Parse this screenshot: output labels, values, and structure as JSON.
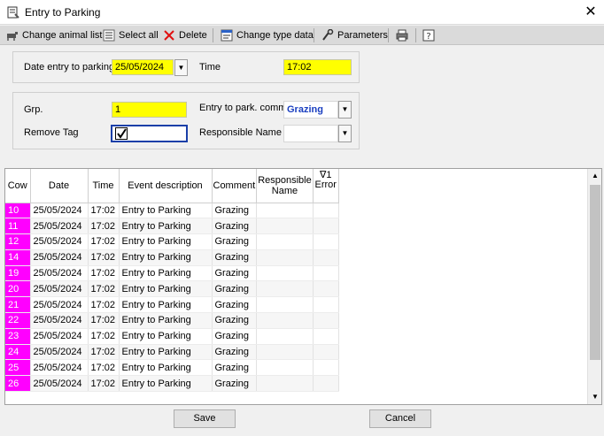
{
  "window": {
    "title": "Entry to Parking",
    "close_glyph": "✕"
  },
  "toolbar": {
    "change_animal_list": "Change animal list",
    "select_all": "Select all",
    "delete": "Delete",
    "change_type_data": "Change type data",
    "parameters": "Parameters"
  },
  "entry": {
    "date_label": "Date entry to parking",
    "date_value": "25/05/2024",
    "time_label": "Time",
    "time_value": "17:02"
  },
  "details": {
    "grp_label": "Grp.",
    "grp_value": "1",
    "comm_label": "Entry to park. comm.",
    "comm_value": "Grazing",
    "remove_tag_label": "Remove Tag",
    "remove_tag_checked": true,
    "responsible_label": "Responsible Name",
    "responsible_value": ""
  },
  "grid": {
    "columns": {
      "cow": "Cow",
      "date": "Date",
      "time": "Time",
      "event": "Event description",
      "comment": "Comment",
      "responsible": "Responsible Name",
      "error_marker": "∇1",
      "error": "Error"
    },
    "rows": [
      {
        "cow": "10",
        "date": "25/05/2024",
        "time": "17:02",
        "event": "Entry to Parking",
        "comment": "Grazing"
      },
      {
        "cow": "11",
        "date": "25/05/2024",
        "time": "17:02",
        "event": "Entry to Parking",
        "comment": "Grazing"
      },
      {
        "cow": "12",
        "date": "25/05/2024",
        "time": "17:02",
        "event": "Entry to Parking",
        "comment": "Grazing"
      },
      {
        "cow": "14",
        "date": "25/05/2024",
        "time": "17:02",
        "event": "Entry to Parking",
        "comment": "Grazing"
      },
      {
        "cow": "19",
        "date": "25/05/2024",
        "time": "17:02",
        "event": "Entry to Parking",
        "comment": "Grazing"
      },
      {
        "cow": "20",
        "date": "25/05/2024",
        "time": "17:02",
        "event": "Entry to Parking",
        "comment": "Grazing"
      },
      {
        "cow": "21",
        "date": "25/05/2024",
        "time": "17:02",
        "event": "Entry to Parking",
        "comment": "Grazing"
      },
      {
        "cow": "22",
        "date": "25/05/2024",
        "time": "17:02",
        "event": "Entry to Parking",
        "comment": "Grazing"
      },
      {
        "cow": "23",
        "date": "25/05/2024",
        "time": "17:02",
        "event": "Entry to Parking",
        "comment": "Grazing"
      },
      {
        "cow": "24",
        "date": "25/05/2024",
        "time": "17:02",
        "event": "Entry to Parking",
        "comment": "Grazing"
      },
      {
        "cow": "25",
        "date": "25/05/2024",
        "time": "17:02",
        "event": "Entry to Parking",
        "comment": "Grazing"
      },
      {
        "cow": "26",
        "date": "25/05/2024",
        "time": "17:02",
        "event": "Entry to Parking",
        "comment": "Grazing"
      }
    ]
  },
  "footer": {
    "save": "Save",
    "cancel": "Cancel"
  },
  "colors": {
    "cow_cell": "#ff00ff",
    "required_field": "#ffff00",
    "accent_text": "#1a3fc0"
  },
  "icons": [
    "app-icon",
    "close-icon",
    "animal-list-icon",
    "select-all-icon",
    "delete-icon",
    "change-type-icon",
    "parameters-icon",
    "print-icon",
    "help-icon",
    "dropdown-arrow-icon",
    "checkbox-icon",
    "filter-icon",
    "scroll-up-icon",
    "scroll-down-icon"
  ]
}
